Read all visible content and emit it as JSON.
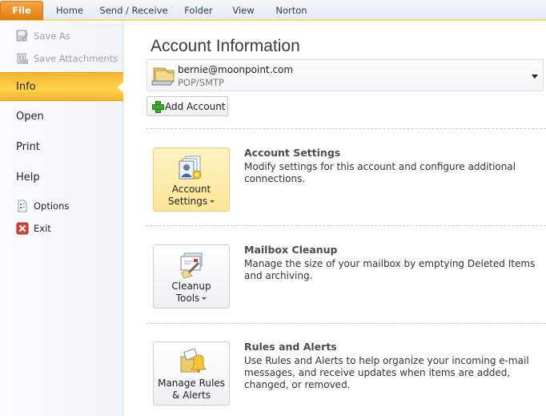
{
  "ribbon": {
    "tabs": [
      {
        "label": "File",
        "active": true
      },
      {
        "label": "Home"
      },
      {
        "label": "Send / Receive"
      },
      {
        "label": "Folder"
      },
      {
        "label": "View"
      },
      {
        "label": "Norton"
      }
    ]
  },
  "nav": {
    "save_as": "Save As",
    "save_attachments": "Save Attachments",
    "info": "Info",
    "open": "Open",
    "print": "Print",
    "help": "Help",
    "options": "Options",
    "exit": "Exit",
    "active": "Info"
  },
  "main": {
    "title": "Account Information",
    "account": {
      "email": "bernie@moonpoint.com",
      "type": "POP/SMTP"
    },
    "add_account_label": "Add Account",
    "sections": [
      {
        "button_line1": "Account",
        "button_line2": "Settings",
        "title": "Account Settings",
        "description": "Modify settings for this account and configure additional connections."
      },
      {
        "button_line1": "Cleanup",
        "button_line2": "Tools",
        "title": "Mailbox Cleanup",
        "description": "Manage the size of your mailbox by emptying Deleted Items and archiving."
      },
      {
        "button_line1": "Manage Rules",
        "button_line2": "& Alerts",
        "title": "Rules and Alerts",
        "description": "Use Rules and Alerts to help organize your incoming e-mail messages, and receive updates when items are added, changed, or removed."
      }
    ]
  },
  "colors": {
    "file_tab": "#e8891f",
    "active_nav": "#fcc73e",
    "ribbon_underline": "#f6d86e",
    "highlight_button": "#fdeaa6"
  }
}
